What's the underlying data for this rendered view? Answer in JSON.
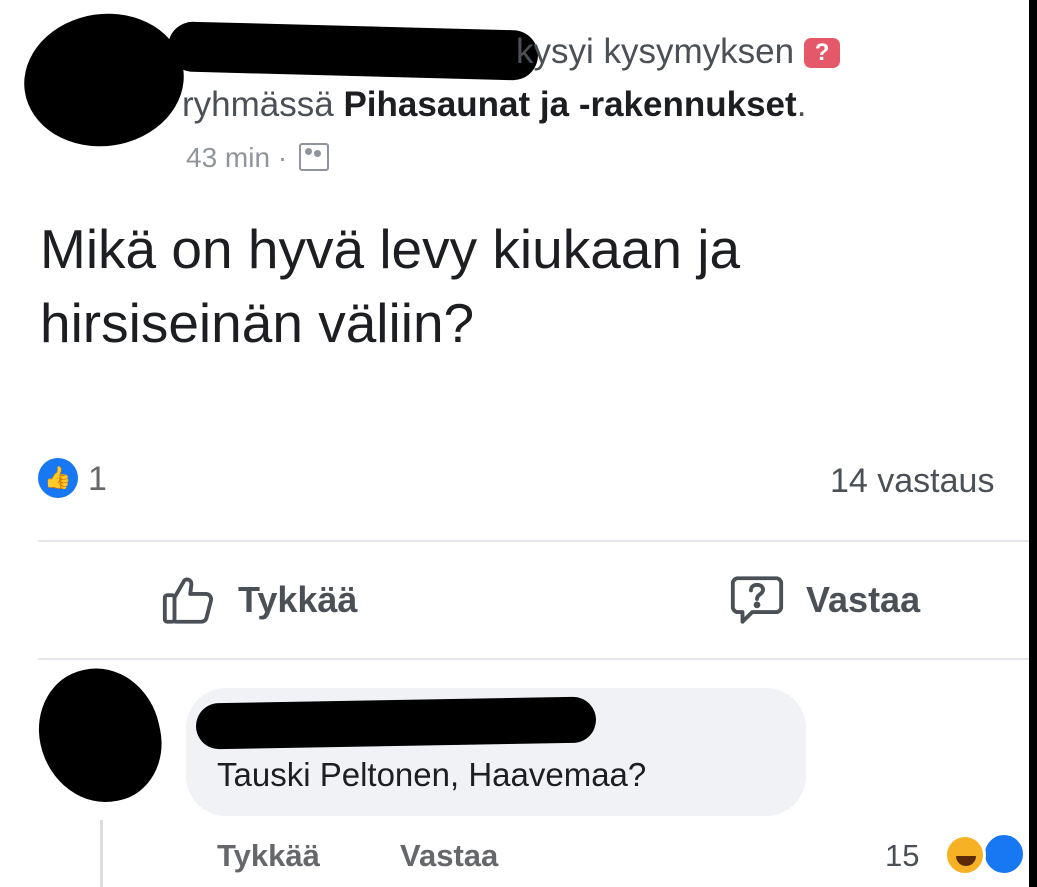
{
  "post": {
    "header_action": "kysyi kysymyksen",
    "question_badge": "?",
    "group_prefix": "ryhmässä",
    "group_name": "Pihasaunat ja -rakennukset",
    "group_suffix": ".",
    "time": "43 min",
    "separator": "·",
    "audience_icon": "group-icon",
    "question": "Mikä on hyvä levy kiukaan ja hirsiseinän väliin?",
    "like_count": "1",
    "answers_count": "14 vastaus"
  },
  "actions": {
    "like_label": "Tykkää",
    "answer_label": "Vastaa"
  },
  "comment": {
    "text": "Tauski Peltonen, Haavemaa?",
    "like_label": "Tykkää",
    "reply_label": "Vastaa",
    "reaction_count": "15",
    "reaction_icons": [
      "haha-icon",
      "like-icon"
    ]
  },
  "colors": {
    "accent": "#1877f2",
    "question_badge": "#e5586a",
    "bubble": "#f0f2f5"
  }
}
